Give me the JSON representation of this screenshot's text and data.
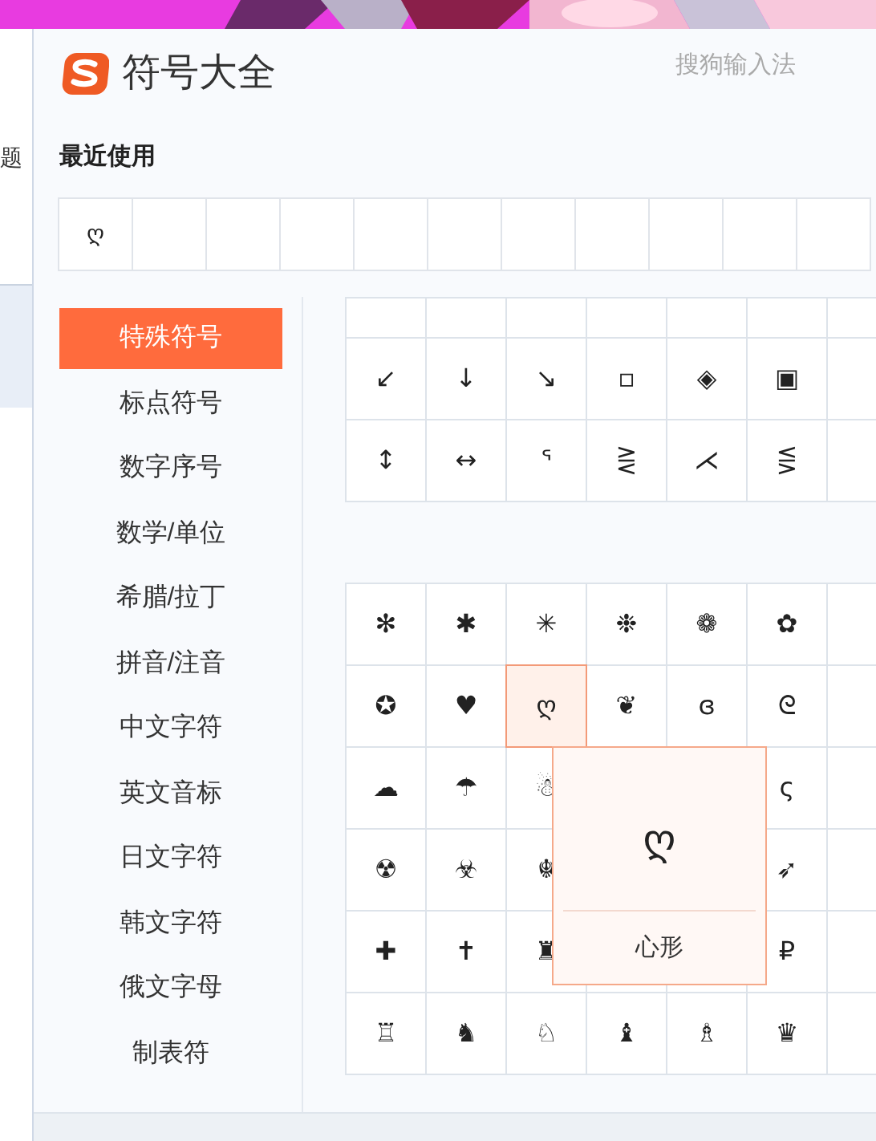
{
  "background_page": {
    "text": "题"
  },
  "window": {
    "title": "符号大全",
    "brand": "搜狗输入法"
  },
  "recent": {
    "title": "最近使用",
    "symbols": [
      "ღ"
    ]
  },
  "categories": [
    {
      "label": "特殊符号",
      "selected": true
    },
    {
      "label": "标点符号",
      "selected": false
    },
    {
      "label": "数字序号",
      "selected": false
    },
    {
      "label": "数学/单位",
      "selected": false
    },
    {
      "label": "希腊/拉丁",
      "selected": false
    },
    {
      "label": "拼音/注音",
      "selected": false
    },
    {
      "label": "中文字符",
      "selected": false
    },
    {
      "label": "英文音标",
      "selected": false
    },
    {
      "label": "日文字符",
      "selected": false
    },
    {
      "label": "韩文字符",
      "selected": false
    },
    {
      "label": "俄文字母",
      "selected": false
    },
    {
      "label": "制表符",
      "selected": false
    }
  ],
  "symbol_grids": [
    {
      "rows": [
        [
          {
            "symbol": "↙",
            "selected": false
          },
          {
            "symbol": "↓",
            "selected": false
          },
          {
            "symbol": "↘",
            "selected": false
          },
          {
            "symbol": "▫",
            "selected": false
          },
          {
            "symbol": "◈",
            "selected": false
          },
          {
            "symbol": "▣",
            "selected": false
          }
        ],
        [
          {
            "symbol": "↕",
            "selected": false
          },
          {
            "symbol": "↔",
            "selected": false
          },
          {
            "symbol": "ᕐ",
            "selected": false
          },
          {
            "symbol": "⋛",
            "selected": false
          },
          {
            "symbol": "⋌",
            "selected": false
          },
          {
            "symbol": "⋚",
            "selected": false
          }
        ]
      ]
    },
    {
      "rows": [
        [
          {
            "symbol": "✻",
            "selected": false
          },
          {
            "symbol": "✱",
            "selected": false
          },
          {
            "symbol": "✳",
            "selected": false
          },
          {
            "symbol": "❉",
            "selected": false
          },
          {
            "symbol": "❁",
            "selected": false
          },
          {
            "symbol": "✿",
            "selected": false
          }
        ],
        [
          {
            "symbol": "✪",
            "selected": false
          },
          {
            "symbol": "♥",
            "selected": false
          },
          {
            "symbol": "ღ",
            "selected": true
          },
          {
            "symbol": "❦",
            "selected": false
          },
          {
            "symbol": "ɞ",
            "selected": false
          },
          {
            "symbol": "ᘓ",
            "selected": false
          }
        ],
        [
          {
            "symbol": "☁",
            "selected": false
          },
          {
            "symbol": "☂",
            "selected": false
          },
          {
            "symbol": "☃",
            "selected": false
          },
          null,
          null,
          {
            "symbol": "ς",
            "selected": false
          }
        ],
        [
          {
            "symbol": "☢",
            "selected": false
          },
          {
            "symbol": "☣",
            "selected": false
          },
          {
            "symbol": "☬",
            "selected": false
          },
          null,
          null,
          {
            "symbol": "➶",
            "selected": false
          }
        ],
        [
          {
            "symbol": "✚",
            "selected": false
          },
          {
            "symbol": "✝",
            "selected": false
          },
          {
            "symbol": "♜",
            "selected": false
          },
          null,
          null,
          {
            "symbol": "₽",
            "selected": false
          }
        ],
        [
          {
            "symbol": "♖",
            "selected": false
          },
          {
            "symbol": "♞",
            "selected": false
          },
          {
            "symbol": "♘",
            "selected": false
          },
          {
            "symbol": "♝",
            "selected": false
          },
          {
            "symbol": "♗",
            "selected": false
          },
          {
            "symbol": "♛",
            "selected": false
          }
        ]
      ]
    }
  ],
  "tooltip": {
    "symbol": "ღ",
    "name": "心形"
  }
}
